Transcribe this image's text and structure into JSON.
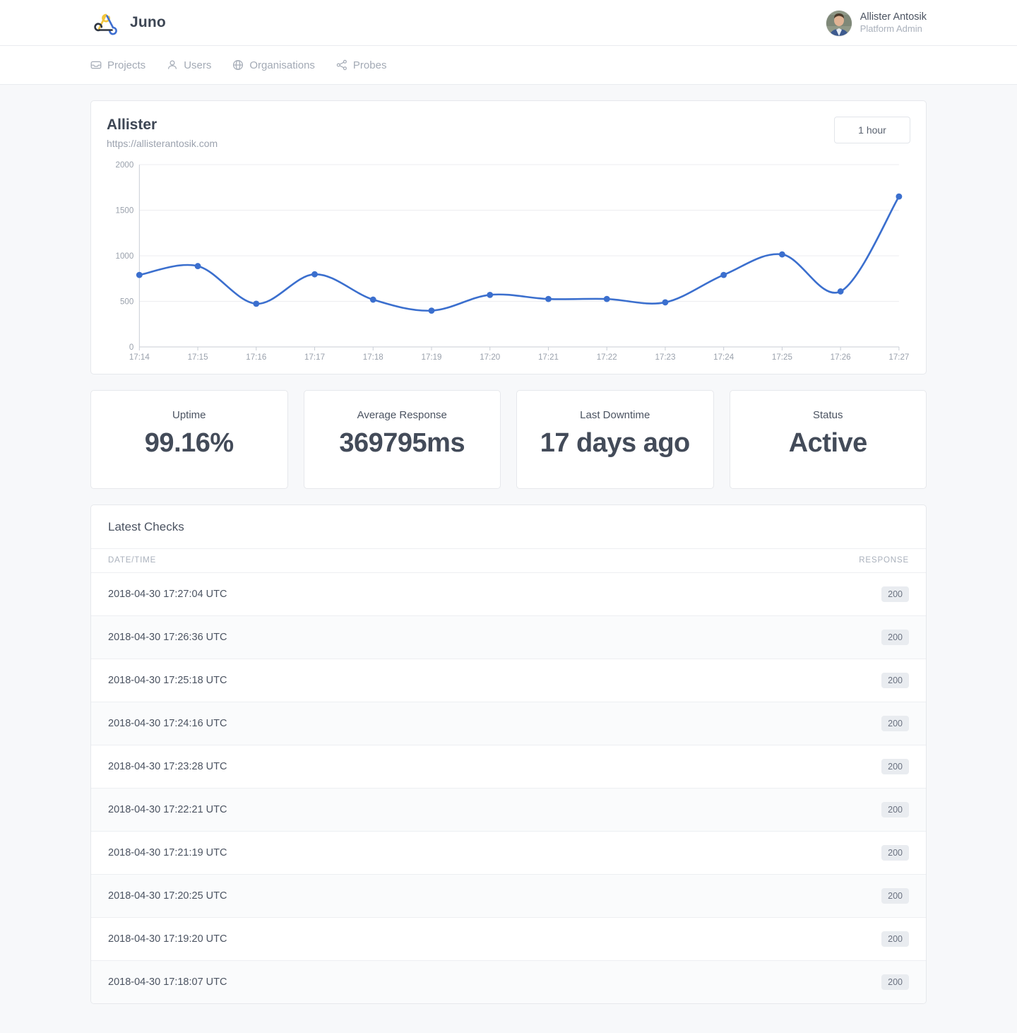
{
  "brand": {
    "name": "Juno",
    "logo_icon": "juno-triangle-logo"
  },
  "user": {
    "name": "Allister Antosik",
    "role": "Platform Admin",
    "avatar_icon": "user-avatar-photo"
  },
  "nav": {
    "items": [
      {
        "label": "Projects",
        "icon": "inbox-icon"
      },
      {
        "label": "Users",
        "icon": "person-icon"
      },
      {
        "label": "Organisations",
        "icon": "globe-icon"
      },
      {
        "label": "Probes",
        "icon": "share-nodes-icon"
      }
    ]
  },
  "monitor": {
    "title": "Allister",
    "url": "https://allisterantosik.com",
    "range_label": "1 hour"
  },
  "chart_data": {
    "type": "line",
    "title": "Allister",
    "xlabel": "",
    "ylabel": "",
    "ylim": [
      0,
      2000
    ],
    "yticks": [
      0,
      500,
      1000,
      1500,
      2000
    ],
    "grid": true,
    "legend": "none",
    "line_color": "#3b6fce",
    "point_color": "#3b6fce",
    "categories": [
      "17:14",
      "17:15",
      "17:16",
      "17:17",
      "17:18",
      "17:19",
      "17:20",
      "17:21",
      "17:22",
      "17:23",
      "17:24",
      "17:25",
      "17:26",
      "17:27"
    ],
    "values": [
      790,
      887,
      474,
      797,
      519,
      398,
      571,
      526,
      526,
      489,
      790,
      1015,
      609,
      1650
    ]
  },
  "stats": [
    {
      "label": "Uptime",
      "value": "99.16%"
    },
    {
      "label": "Average Response",
      "value": "369795ms"
    },
    {
      "label": "Last Downtime",
      "value": "17 days ago"
    },
    {
      "label": "Status",
      "value": "Active"
    }
  ],
  "latest_checks": {
    "title": "Latest Checks",
    "columns": {
      "date": "DATE/TIME",
      "response": "RESPONSE"
    },
    "rows": [
      {
        "datetime": "2018-04-30 17:27:04 UTC",
        "response": "200"
      },
      {
        "datetime": "2018-04-30 17:26:36 UTC",
        "response": "200"
      },
      {
        "datetime": "2018-04-30 17:25:18 UTC",
        "response": "200"
      },
      {
        "datetime": "2018-04-30 17:24:16 UTC",
        "response": "200"
      },
      {
        "datetime": "2018-04-30 17:23:28 UTC",
        "response": "200"
      },
      {
        "datetime": "2018-04-30 17:22:21 UTC",
        "response": "200"
      },
      {
        "datetime": "2018-04-30 17:21:19 UTC",
        "response": "200"
      },
      {
        "datetime": "2018-04-30 17:20:25 UTC",
        "response": "200"
      },
      {
        "datetime": "2018-04-30 17:19:20 UTC",
        "response": "200"
      },
      {
        "datetime": "2018-04-30 17:18:07 UTC",
        "response": "200"
      }
    ]
  }
}
